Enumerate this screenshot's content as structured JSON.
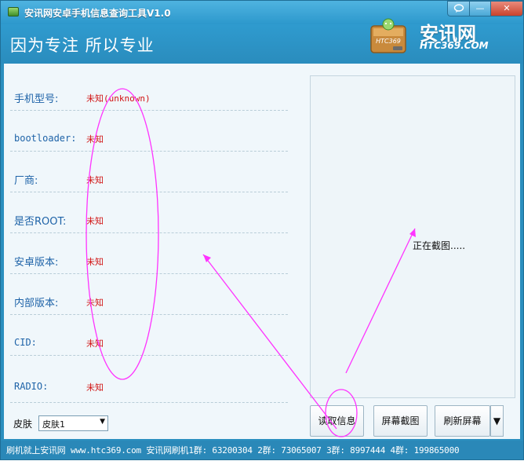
{
  "window": {
    "title": "安讯网安卓手机信息查询工具V1.0",
    "controls": {
      "feedback_icon": "speech-bubble-icon",
      "minimize_label": "—",
      "close_label": "✕"
    }
  },
  "header": {
    "slogan": "因为专注 所以专业",
    "brand": "安讯网",
    "brand_url": "HTC369.COM",
    "badge_text": "HTC369"
  },
  "info": {
    "rows": [
      {
        "label": "手机型号:",
        "value": "未知(unknown)"
      },
      {
        "label": "bootloader:",
        "value": "未知"
      },
      {
        "label": "厂商:",
        "value": "未知"
      },
      {
        "label": "是否ROOT:",
        "value": "未知"
      },
      {
        "label": "安卓版本:",
        "value": "未知"
      },
      {
        "label": "内部版本:",
        "value": "未知"
      },
      {
        "label": "CID:",
        "value": "未知"
      },
      {
        "label": "RADIO:",
        "value": "未知"
      }
    ]
  },
  "preview": {
    "status": "正在截图....."
  },
  "skin": {
    "label": "皮肤",
    "selected": "皮肤1"
  },
  "actions": {
    "read_label": "读取信息",
    "screenshot_label": "屏幕截图",
    "refresh_label": "刷新屏幕",
    "more_label": "▼"
  },
  "statusbar": {
    "text": "刷机就上安讯网 www.htc369.com  安讯网刷机1群: 63200304 2群: 73065007 3群: 8997444 4群: 199865000"
  },
  "colors": {
    "accent": "#2b8fbf",
    "annotation": "#ff33ff",
    "value_red": "#d11414",
    "label_blue": "#1e63a8"
  }
}
